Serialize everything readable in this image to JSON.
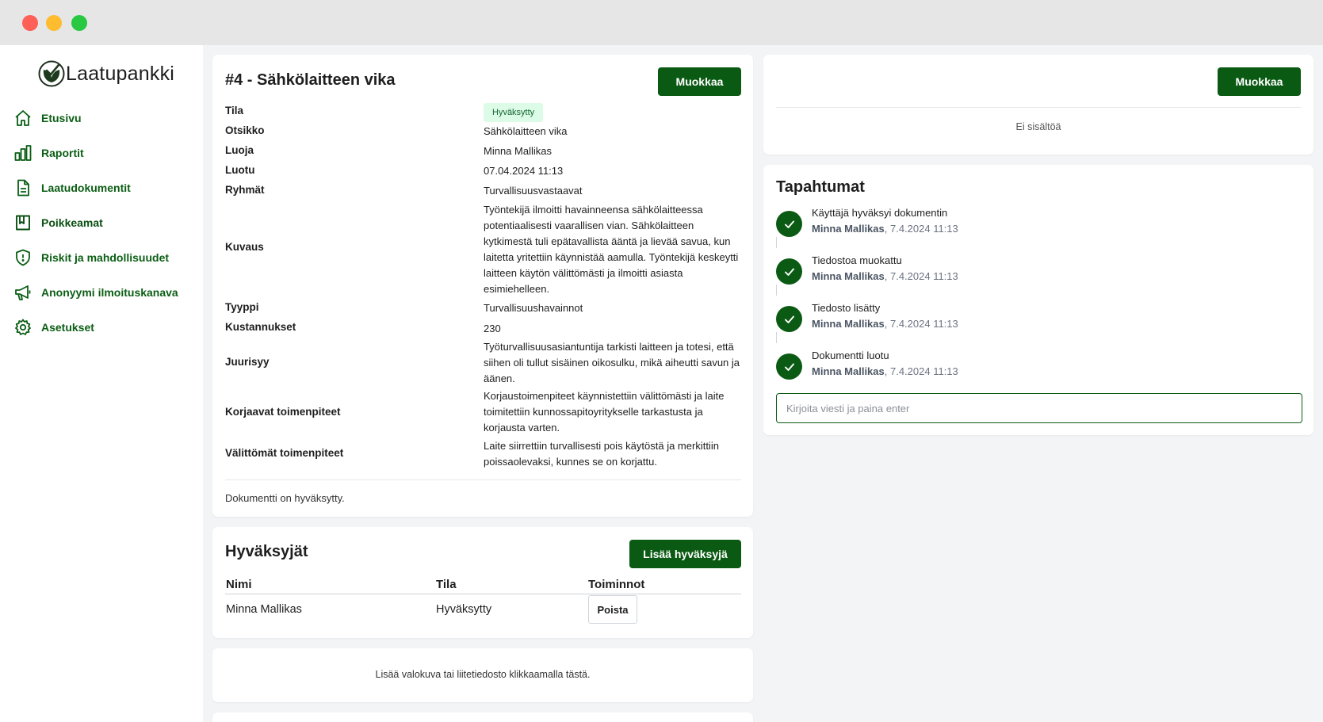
{
  "brand": {
    "name": "Laatupankki"
  },
  "sidebar": {
    "items": [
      {
        "label": "Etusivu",
        "icon": "home-icon"
      },
      {
        "label": "Raportit",
        "icon": "bar-chart-icon"
      },
      {
        "label": "Laatudokumentit",
        "icon": "document-icon"
      },
      {
        "label": "Poikkeamat",
        "icon": "book-icon",
        "active": true
      },
      {
        "label": "Riskit ja mahdollisuudet",
        "icon": "shield-icon"
      },
      {
        "label": "Anonyymi ilmoituskanava",
        "icon": "megaphone-icon"
      },
      {
        "label": "Asetukset",
        "icon": "gear-icon"
      }
    ]
  },
  "document": {
    "title": "#4 - Sähkölaitteen vika",
    "edit_label": "Muokkaa",
    "fields": [
      {
        "label": "Tila",
        "value": "Hyväksytty"
      },
      {
        "label": "Otsikko",
        "value": "Sähkölaitteen vika"
      },
      {
        "label": "Luoja",
        "value": "Minna Mallikas"
      },
      {
        "label": "Luotu",
        "value": "07.04.2024 11:13"
      },
      {
        "label": "Ryhmät",
        "value": "Turvallisuusvastaavat"
      },
      {
        "label": "Kuvaus",
        "value": "Työntekijä ilmoitti havainneensa sähkölaitteessa potentiaalisesti vaarallisen vian. Sähkölaitteen kytkimestä tuli epätavallista ääntä ja lievää savua, kun laitetta yritettiin käynnistää aamulla. Työntekijä keskeytti laitteen käytön välittömästi ja ilmoitti asiasta esimiehelleen."
      },
      {
        "label": "Tyyppi",
        "value": "Turvallisuushavainnot"
      },
      {
        "label": "Kustannukset",
        "value": "230"
      },
      {
        "label": "Juurisyy",
        "value": "Työturvallisuusasiantuntija tarkisti laitteen ja totesi, että siihen oli tullut sisäinen oikosulku, mikä aiheutti savun ja äänen."
      },
      {
        "label": "Korjaavat toimenpiteet",
        "value": "Korjaustoimenpiteet käynnistettiin välittömästi ja laite toimitettiin kunnossapitoyritykselle tarkastusta ja korjausta varten."
      },
      {
        "label": "Välittömät toimenpiteet",
        "value": "Laite siirrettiin turvallisesti pois käytöstä ja merkittiin poissaolevaksi, kunnes se on korjattu."
      }
    ],
    "status_note": "Dokumentti on hyväksytty."
  },
  "approvers": {
    "title": "Hyväksyjät",
    "add_label": "Lisää hyväksyjä",
    "headers": {
      "name": "Nimi",
      "status": "Tila",
      "actions": "Toiminnot"
    },
    "rows": [
      {
        "name": "Minna Mallikas",
        "status": "Hyväksytty",
        "action": "Poista"
      }
    ]
  },
  "attachment": {
    "text": "Lisää valokuva tai liitetiedosto klikkaamalla tästä."
  },
  "content_panel": {
    "edit_label": "Muokkaa",
    "empty_text": "Ei sisältöä"
  },
  "events": {
    "title": "Tapahtumat",
    "items": [
      {
        "text": "Käyttäjä hyväksyi dokumentin",
        "user": "Minna Mallikas",
        "time": ", 7.4.2024 11:13"
      },
      {
        "text": "Tiedostoa muokattu",
        "user": "Minna Mallikas",
        "time": ", 7.4.2024 11:13"
      },
      {
        "text": "Tiedosto lisätty",
        "user": "Minna Mallikas",
        "time": ", 7.4.2024 11:13"
      },
      {
        "text": "Dokumentti luotu",
        "user": "Minna Mallikas",
        "time": ", 7.4.2024 11:13"
      }
    ],
    "input_placeholder": "Kirjoita viesti ja paina enter"
  },
  "colors": {
    "brand_green": "#0b5a13",
    "badge_bg": "#dcfce7",
    "badge_text": "#166534",
    "nav_text": "#0b5e14"
  }
}
